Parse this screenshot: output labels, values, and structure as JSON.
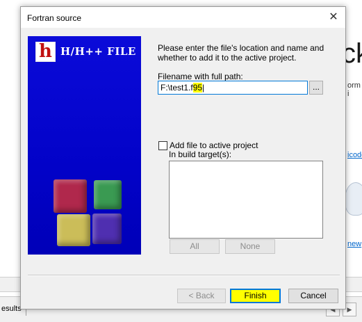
{
  "background": {
    "big_text": "ck",
    "form_text": "orm i",
    "link1": "icode",
    "link2": "new",
    "tab_label": "esults"
  },
  "dialog": {
    "title": "Fortran source",
    "close_glyph": "✕",
    "graphic": {
      "logo_letter": "h",
      "title": "H/H++ FILE"
    },
    "instructions": "Please enter the file's location and name and whether to add it to the active project.",
    "filename_label": "Filename with full path:",
    "filename_value_plain": "F:\\test1.f",
    "filename_value_highlight": "95",
    "browse_label": "...",
    "add_checkbox_label": "Add file to active project",
    "add_checkbox_checked": false,
    "targets_label": "In build target(s):",
    "targets": [],
    "all_button": "All",
    "none_button": "None",
    "back_button": "< Back",
    "finish_button": "Finish",
    "cancel_button": "Cancel"
  },
  "colors": {
    "highlight": "#ffff00",
    "accent": "#0078d7",
    "graphic_blue": "#0202c8"
  }
}
